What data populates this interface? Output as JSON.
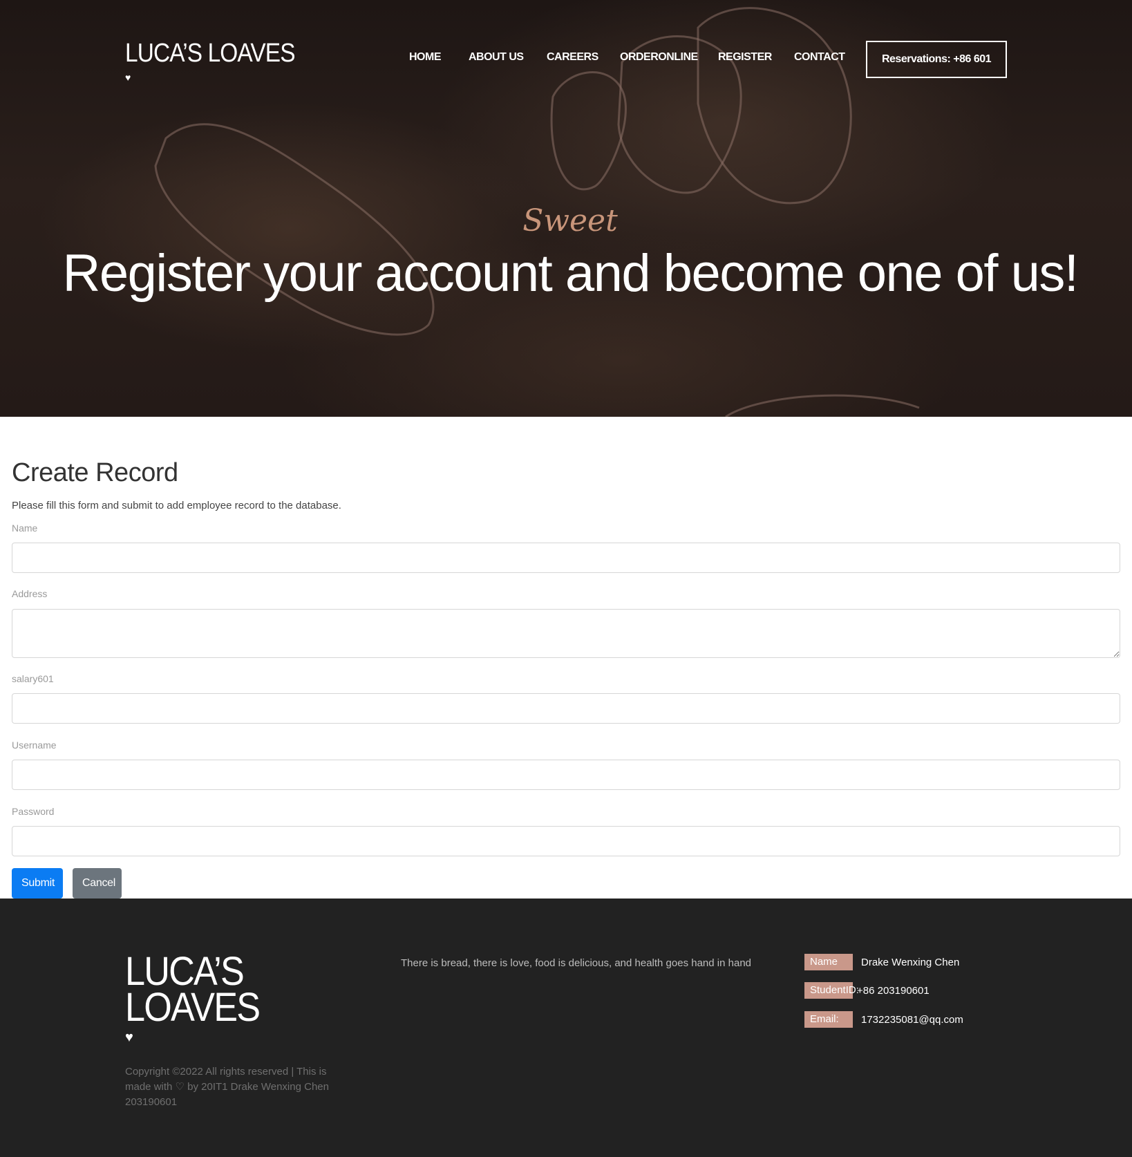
{
  "header": {
    "logo": "LUCA’S LOAVES",
    "logo_heart": "♥",
    "nav": [
      "HOME",
      "ABOUT US",
      "CAREERS",
      "ORDERONLINE",
      "REGISTER",
      "CONTACT"
    ],
    "reservations": "Reservations: +86 601"
  },
  "hero": {
    "script_word": "Sweet",
    "headline": "Register your account and become one of us!"
  },
  "form": {
    "title": "Create Record",
    "description": "Please fill this form and submit to add employee record to the database.",
    "fields": [
      {
        "label": "Name",
        "value": ""
      },
      {
        "label": "Address",
        "value": ""
      },
      {
        "label": "salary601",
        "value": ""
      },
      {
        "label": "Username",
        "value": ""
      },
      {
        "label": "Password",
        "value": ""
      }
    ],
    "submit_label": "Submit",
    "cancel_label": "Cancel",
    "submit_color": "#0b7cf3",
    "cancel_color": "#6c757d"
  },
  "footer": {
    "logo_line1": "LUCA’S",
    "logo_line2": "LOAVES",
    "heart": "♥",
    "copyright": "Copyright ©2022 All rights reserved | This is made with ♡ by 20IT1 Drake Wenxing Chen 203190601",
    "tagline": "There is bread, there is love, food is delicious, and health goes hand in hand",
    "info": [
      {
        "label": "Name",
        "value": "Drake Wenxing Chen"
      },
      {
        "label": "StudentID:",
        "value": "+86 203190601"
      },
      {
        "label": "Email:",
        "value": "1732235081@qq.com"
      }
    ],
    "badge_color": "#c9988a"
  }
}
